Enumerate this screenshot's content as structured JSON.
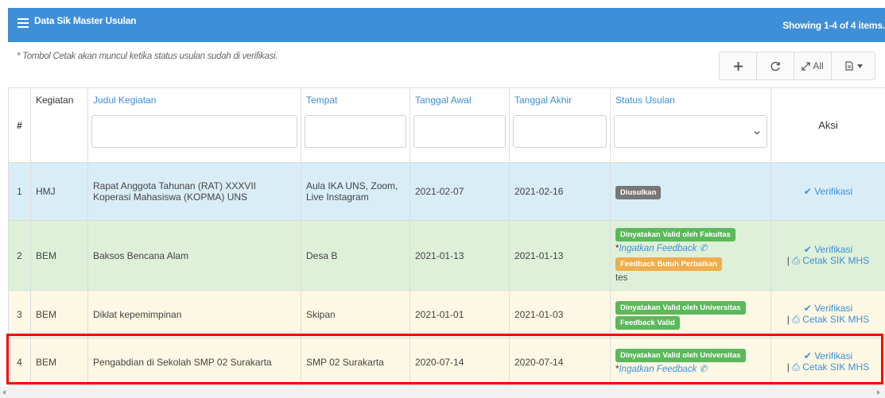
{
  "panel": {
    "title": "Data Sik Master Usulan",
    "summary": "Showing 1-4 of 4 items."
  },
  "note": "* Tombol Cetak akan muncul ketika status usulan sudah di verifikasi.",
  "toolbar": {
    "all_label": "All"
  },
  "columns": {
    "hash": "#",
    "kegiatan": "Kegiatan",
    "judul": "Judul Kegiatan",
    "tempat": "Tempat",
    "tanggal_awal": "Tanggal Awal",
    "tanggal_akhir": "Tanggal Akhir",
    "status": "Status Usulan",
    "aksi": "Aksi"
  },
  "rows": [
    {
      "no": "1",
      "kegiatan": "HMJ",
      "judul": "Rapat Anggota Tahunan (RAT) XXXVII Koperasi Mahasiswa (KOPMA) UNS",
      "tempat": "Aula IKA UNS, Zoom, Live Instagram",
      "tanggal_awal": "2021-02-07",
      "tanggal_akhir": "2021-02-16",
      "badge1": "Diusulkan",
      "verify": "Verifikasi"
    },
    {
      "no": "2",
      "kegiatan": "BEM",
      "judul": "Baksos Bencana Alam",
      "tempat": "Desa B",
      "tanggal_awal": "2021-01-13",
      "tanggal_akhir": "2021-01-13",
      "badge1": "Dinyatakan Valid oleh Fakultas",
      "hint": "Ingatkan Feedback",
      "badge2": "Feedback Butuh Perbaikan",
      "extra": "tes",
      "verify": "Verifikasi",
      "print": "Cetak SIK MHS"
    },
    {
      "no": "3",
      "kegiatan": "BEM",
      "judul": "Diklat kepemimpinan",
      "tempat": "Skipan",
      "tanggal_awal": "2021-01-01",
      "tanggal_akhir": "2021-01-03",
      "badge1": "Dinyatakan Valid oleh Universitas",
      "badge2": "Feedback Valid",
      "verify": "Verifikasi",
      "print": "Cetak SIK MHS"
    },
    {
      "no": "4",
      "kegiatan": "BEM",
      "judul": "Pengabdian di Sekolah SMP 02 Surakarta",
      "tempat": "SMP 02 Surakarta",
      "tanggal_awal": "2020-07-14",
      "tanggal_akhir": "2020-07-14",
      "badge1": "Dinyatakan Valid oleh Universitas",
      "hint": "Ingatkan Feedback",
      "verify": "Verifikasi",
      "print": "Cetak SIK MHS"
    }
  ],
  "colors": {
    "primary": "#3e8fd8",
    "row_info": "#d9edf7",
    "row_success": "#dff0d8",
    "row_warning": "#fcf8e3",
    "badge_default": "#777777",
    "badge_success": "#5cb85c",
    "badge_warning": "#f0ad4e",
    "highlight": "#ff0000"
  }
}
